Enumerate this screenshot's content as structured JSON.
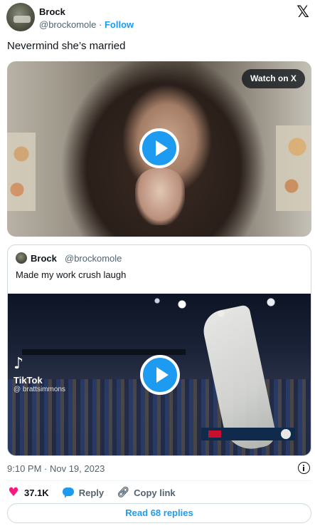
{
  "author": {
    "name": "Brock",
    "handle": "@brockomole",
    "separator": " · ",
    "follow_label": "Follow"
  },
  "brand_icon": "x-logo-icon",
  "tweet": {
    "text": "Nevermind she’s married"
  },
  "media": {
    "watch_label": "Watch on X",
    "play_icon": "play-icon"
  },
  "quote": {
    "name": "Brock",
    "handle": "@brockomole",
    "text": "Made my work crush laugh",
    "overlay": {
      "tiktok_mark": "♪",
      "tiktok_name": "TikTok",
      "tiktok_user": "@ brattsimmons"
    }
  },
  "footer": {
    "timestamp": "9:10 PM · Nov 19, 2023",
    "info_icon": "info-icon"
  },
  "actions": {
    "like_count": "37.1K",
    "reply_label": "Reply",
    "copy_link_label": "Copy link"
  },
  "read_replies_label": "Read 68 replies",
  "colors": {
    "accent": "#1d9bf0",
    "like": "#f91880",
    "text": "#0f1419",
    "muted": "#536471",
    "border": "#cfd9de"
  }
}
